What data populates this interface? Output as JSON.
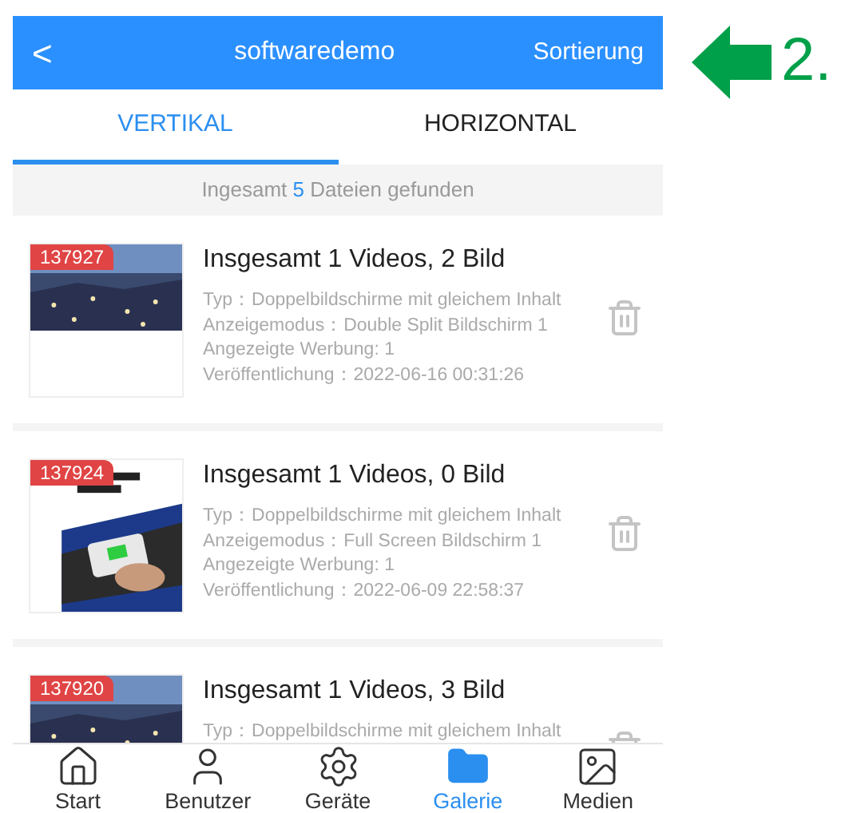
{
  "header": {
    "back": "<",
    "title": "softwaredemo",
    "action": "Sortierung"
  },
  "tabs": [
    {
      "label": "VERTIKAL",
      "selected": true
    },
    {
      "label": "HORIZONTAL",
      "selected": false
    }
  ],
  "summary": {
    "prefix": "Ingesamt",
    "count": "5",
    "suffix": "Dateien gefunden"
  },
  "items": [
    {
      "id": "137927",
      "title": "Insgesamt 1 Videos, 2 Bild",
      "details": [
        "Typ：Doppelbildschirme mit gleichem Inhalt",
        "Anzeigemodus：Double Split Bildschirm 1",
        "Angezeigte Werbung: 1",
        "Veröffentlichung：2022-06-16 00:31:26"
      ]
    },
    {
      "id": "137924",
      "title": "Insgesamt 1 Videos, 0 Bild",
      "details": [
        "Typ：Doppelbildschirme mit gleichem Inhalt",
        "Anzeigemodus：Full Screen Bildschirm 1",
        "Angezeigte Werbung: 1",
        "Veröffentlichung：2022-06-09 22:58:37"
      ]
    },
    {
      "id": "137920",
      "title": "Insgesamt 1 Videos, 3 Bild",
      "details": [
        "Typ：Doppelbildschirme mit gleichem Inhalt"
      ]
    }
  ],
  "nav": [
    {
      "label": "Start",
      "selected": false
    },
    {
      "label": "Benutzer",
      "selected": false
    },
    {
      "label": "Geräte",
      "selected": false
    },
    {
      "label": "Galerie",
      "selected": true
    },
    {
      "label": "Medien",
      "selected": false
    }
  ],
  "annotation": {
    "label": "2."
  }
}
